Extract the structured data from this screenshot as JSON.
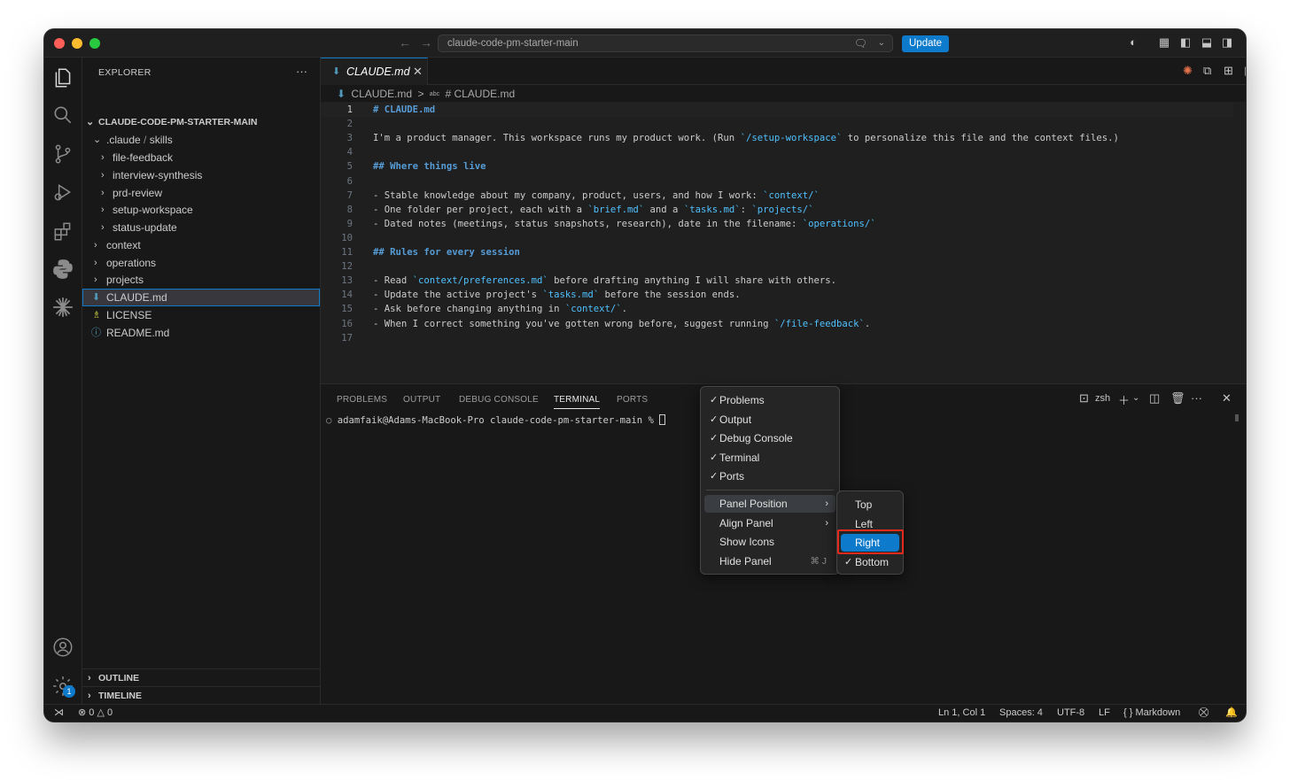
{
  "titlebar": {
    "search_text": "claude-code-pm-starter-main",
    "update_label": "Update"
  },
  "sidebar": {
    "title": "EXPLORER",
    "more": "···",
    "root": "CLAUDE-CODE-PM-STARTER-MAIN",
    "items": [
      {
        "label": ".claude",
        "label2": "skills",
        "sep": "/",
        "kind": "folder-open",
        "depth": 1
      },
      {
        "label": "file-feedback",
        "kind": "folder",
        "depth": 2
      },
      {
        "label": "interview-synthesis",
        "kind": "folder",
        "depth": 2
      },
      {
        "label": "prd-review",
        "kind": "folder",
        "depth": 2
      },
      {
        "label": "setup-workspace",
        "kind": "folder",
        "depth": 2
      },
      {
        "label": "status-update",
        "kind": "folder",
        "depth": 2
      },
      {
        "label": "context",
        "kind": "folder",
        "depth": 1
      },
      {
        "label": "operations",
        "kind": "folder",
        "depth": 1
      },
      {
        "label": "projects",
        "kind": "folder",
        "depth": 1
      },
      {
        "label": "CLAUDE.md",
        "kind": "file-md",
        "depth": 1,
        "selected": true
      },
      {
        "label": "LICENSE",
        "kind": "file-license",
        "depth": 1
      },
      {
        "label": "README.md",
        "kind": "file-info",
        "depth": 1
      }
    ],
    "outline": "OUTLINE",
    "timeline": "TIMELINE",
    "settings_badge": "1"
  },
  "editor": {
    "tab_label": "CLAUDE.md",
    "breadcrumb": [
      "CLAUDE.md",
      ">",
      "abc",
      "# CLAUDE.md"
    ],
    "lines": [
      {
        "n": "1",
        "parts": [
          {
            "t": "# CLAUDE.md",
            "c": "h"
          }
        ]
      },
      {
        "n": "2",
        "parts": []
      },
      {
        "n": "3",
        "parts": [
          {
            "t": "I'm a product manager. This workspace runs my product work. (Run "
          },
          {
            "t": "`/setup-workspace`",
            "c": "cb"
          },
          {
            "t": " to personalize this file and the context files.)"
          }
        ]
      },
      {
        "n": "4",
        "parts": []
      },
      {
        "n": "5",
        "parts": [
          {
            "t": "## Where things live",
            "c": "h"
          }
        ]
      },
      {
        "n": "6",
        "parts": []
      },
      {
        "n": "7",
        "parts": [
          {
            "t": "- Stable knowledge about my company, product, users, and how I work: "
          },
          {
            "t": "`context/`",
            "c": "cb"
          }
        ]
      },
      {
        "n": "8",
        "parts": [
          {
            "t": "- One folder per project, each with a "
          },
          {
            "t": "`brief.md`",
            "c": "cb"
          },
          {
            "t": " and a "
          },
          {
            "t": "`tasks.md`",
            "c": "cb"
          },
          {
            "t": ": "
          },
          {
            "t": "`projects/`",
            "c": "cb"
          }
        ]
      },
      {
        "n": "9",
        "parts": [
          {
            "t": "- Dated notes (meetings, status snapshots, research), date in the filename: "
          },
          {
            "t": "`operations/`",
            "c": "cb"
          }
        ]
      },
      {
        "n": "10",
        "parts": []
      },
      {
        "n": "11",
        "parts": [
          {
            "t": "## Rules for every session",
            "c": "h"
          }
        ]
      },
      {
        "n": "12",
        "parts": []
      },
      {
        "n": "13",
        "parts": [
          {
            "t": "- Read "
          },
          {
            "t": "`context/preferences.md`",
            "c": "cb"
          },
          {
            "t": " before drafting anything I will share with others."
          }
        ]
      },
      {
        "n": "14",
        "parts": [
          {
            "t": "- Update the active project's "
          },
          {
            "t": "`tasks.md`",
            "c": "cb"
          },
          {
            "t": " before the session ends."
          }
        ]
      },
      {
        "n": "15",
        "parts": [
          {
            "t": "- Ask before changing anything in "
          },
          {
            "t": "`context/`",
            "c": "cb"
          },
          {
            "t": "."
          }
        ]
      },
      {
        "n": "16",
        "parts": [
          {
            "t": "- When I correct something you've gotten wrong before, suggest running "
          },
          {
            "t": "`/file-feedback`",
            "c": "cb"
          },
          {
            "t": "."
          }
        ]
      },
      {
        "n": "17",
        "parts": []
      }
    ]
  },
  "panel": {
    "tabs": [
      "PROBLEMS",
      "OUTPUT",
      "DEBUG CONSOLE",
      "TERMINAL",
      "PORTS"
    ],
    "active_tab": "TERMINAL",
    "shell": "zsh",
    "prompt": "adamfaik@Adams-MacBook-Pro claude-code-pm-starter-main % "
  },
  "context_menu": {
    "items": [
      {
        "label": "Problems",
        "checked": true
      },
      {
        "label": "Output",
        "checked": true
      },
      {
        "label": "Debug Console",
        "checked": true
      },
      {
        "label": "Terminal",
        "checked": true
      },
      {
        "label": "Ports",
        "checked": true
      }
    ],
    "actions": [
      {
        "label": "Panel Position",
        "submenu": true,
        "hover": true
      },
      {
        "label": "Align Panel",
        "submenu": true
      },
      {
        "label": "Show Icons"
      },
      {
        "label": "Hide Panel",
        "shortcut": "⌘ J"
      }
    ]
  },
  "submenu": {
    "items": [
      {
        "label": "Top"
      },
      {
        "label": "Left"
      },
      {
        "label": "Right",
        "active": true,
        "highlighted": true
      },
      {
        "label": "Bottom",
        "checked": true
      }
    ]
  },
  "statusbar": {
    "errors": "0",
    "warnings": "0",
    "position": "Ln 1, Col 1",
    "spaces": "Spaces: 4",
    "encoding": "UTF-8",
    "eol": "LF",
    "language": "Markdown",
    "language_prefix": "{ }"
  },
  "colors": {
    "accent": "#0e7acc",
    "highlight_border": "#e5281c",
    "heading": "#569cd6",
    "code_span": "#4fc1ff"
  }
}
